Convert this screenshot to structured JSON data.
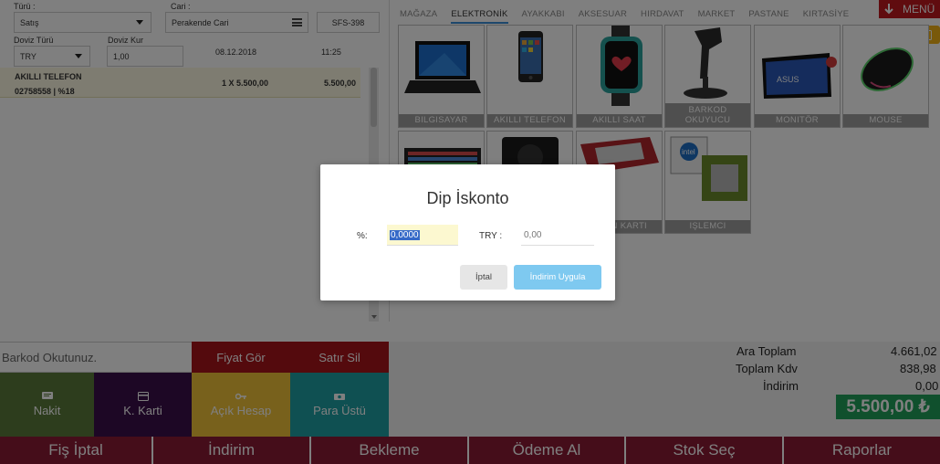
{
  "form": {
    "turu_label": "Türü :",
    "turu_value": "Satış",
    "cari_label": "Cari :",
    "cari_value": "Perakende Cari",
    "fis_no": "SFS-398",
    "doviz_turu_label": "Doviz Türü",
    "doviz_turu_value": "TRY",
    "doviz_kur_label": "Doviz Kur",
    "doviz_kur_value": "1,00",
    "date": "08.12.2018",
    "time": "11:25"
  },
  "line_item": {
    "name": "AKILLI TELEFON",
    "code_vat": "02758558 | %18",
    "qty_price": "1 X 5.500,00",
    "total": "5.500,00"
  },
  "categories": [
    "MAĞAZA",
    "ELEKTRONİK",
    "AYAKKABI",
    "AKSESUAR",
    "HIRDAVAT",
    "MARKET",
    "PASTANE",
    "KIRTASİYE"
  ],
  "active_category": "ELEKTRONİK",
  "menu_label": "MENÜ",
  "products_row1": [
    "BILGISAYAR",
    "AKILLI TELEFON",
    "AKILLI SAAT",
    "BARKOD OKUYUCU",
    "MONITÖR",
    "MOUSE"
  ],
  "products_row2": [
    "",
    "",
    "N KARTI",
    "IŞLEMCI"
  ],
  "bottom": {
    "barkod_placeholder": "Barkod Okutunuz.",
    "fiyat_gor": "Fiyat Gör",
    "satir_sil": "Satır Sil",
    "nakit": "Nakit",
    "k_karti": "K. Karti",
    "acik_hesap": "Açık Hesap",
    "para_ustu": "Para Üstü"
  },
  "totals": {
    "ara_toplam_label": "Ara Toplam",
    "ara_toplam_value": "4.661,02",
    "toplam_kdv_label": "Toplam Kdv",
    "toplam_kdv_value": "838,98",
    "indirim_label": "İndirim",
    "indirim_value": "0,00",
    "grand_total": "5.500,00 ₺"
  },
  "actions": [
    "Fiş İptal",
    "İndirim",
    "Bekleme",
    "Ödeme Al",
    "Stok Seç",
    "Raporlar"
  ],
  "modal": {
    "title": "Dip İskonto",
    "percent_label": "%:",
    "percent_value": "0,0000",
    "try_label": "TRY :",
    "try_placeholder": "0,00",
    "cancel_label": "İptal",
    "apply_label": "İndirim Uygula"
  },
  "colors": {
    "active_tab": "#3a8fd8",
    "menu_red": "#c0181e",
    "keyboard_yellow": "#f2b216",
    "nakit_green": "#5a7a3a",
    "k_karti_purple": "#3b0f4a",
    "acik_hesap_yellow": "#f1c338",
    "para_ustu_teal": "#1fa0a5",
    "fiyat_red": "#a8141a",
    "grand_green": "#21a05a",
    "action_maroon": "#8b1a34"
  }
}
